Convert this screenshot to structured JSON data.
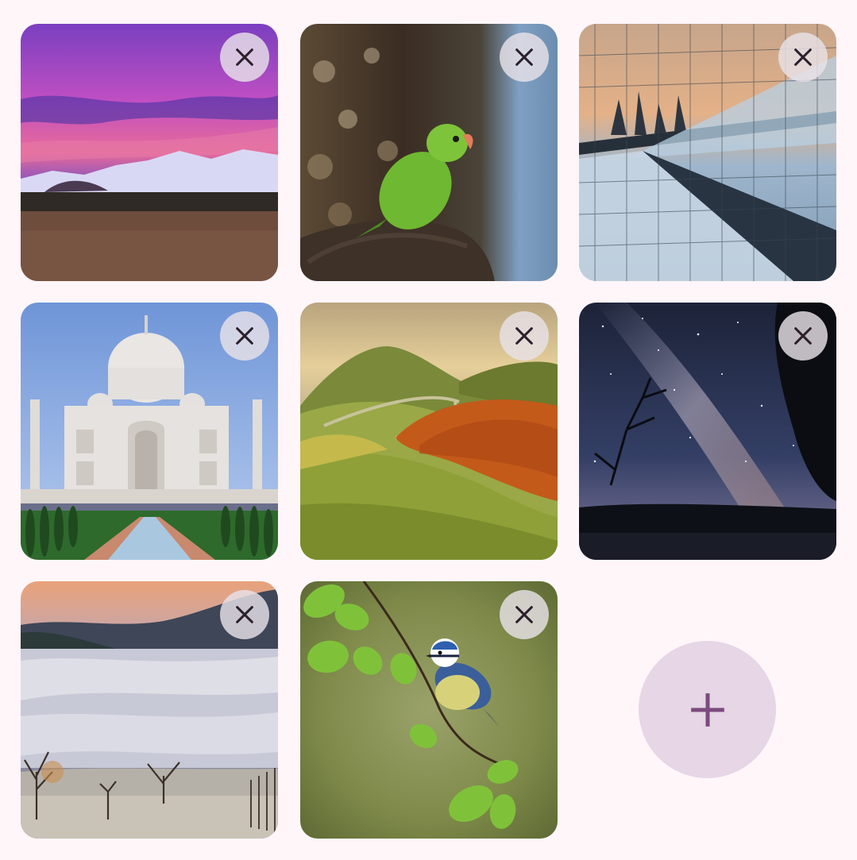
{
  "gallery": {
    "images": [
      {
        "name": "image-mountain-sunset",
        "remove_icon": "close-icon"
      },
      {
        "name": "image-green-parrot",
        "remove_icon": "close-icon"
      },
      {
        "name": "image-glass-building",
        "remove_icon": "close-icon"
      },
      {
        "name": "image-taj-mahal",
        "remove_icon": "close-icon"
      },
      {
        "name": "image-green-hills",
        "remove_icon": "close-icon"
      },
      {
        "name": "image-milky-way",
        "remove_icon": "close-icon"
      },
      {
        "name": "image-foggy-valley",
        "remove_icon": "close-icon"
      },
      {
        "name": "image-blue-tit-bird",
        "remove_icon": "close-icon"
      }
    ],
    "add_icon": "plus-icon"
  },
  "colors": {
    "background": "#fff6fa",
    "remove_button_bg": "#e8e2e8",
    "icon_color": "#2b1f2b",
    "add_button_bg": "#e6d6e6",
    "add_icon_color": "#7b4a7e"
  }
}
